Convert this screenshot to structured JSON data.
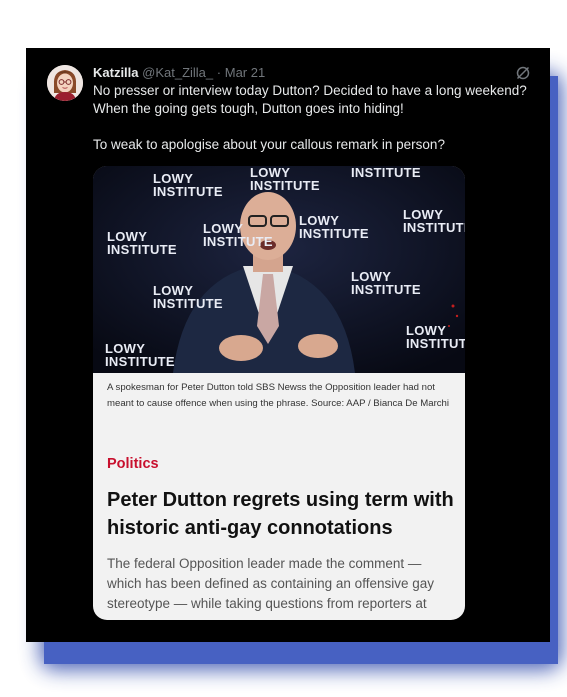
{
  "tweet": {
    "display_name": "Katzilla",
    "handle": "@Kat_Zilla_",
    "separator": "·",
    "date": "Mar 21",
    "text_lines": [
      "No presser or interview today Dutton? Decided to have a long weekend?",
      "When the going gets tough, Dutton goes into hiding!"
    ],
    "text_line_3": "To weak to apologise about your callous remark in person?"
  },
  "article": {
    "photo_logo_words": [
      "LOWY",
      "INSTITUTE"
    ],
    "caption": "A spokesman for Peter Dutton told SBS Newss the Opposition leader had not meant to cause offence when using the phrase. Source: AAP / Bianca De Marchi",
    "category": "Politics",
    "headline": "Peter Dutton regrets using term with historic anti-gay connotations",
    "summary": "The federal Opposition leader made the comment — which has been defined as containing an offensive gay stereotype — while taking questions from reporters at"
  },
  "colors": {
    "card_bg": "#000000",
    "frame_shadow": "#4761c2",
    "category": "#c8102e",
    "text_primary": "#e7e9ea",
    "text_muted": "#71767b"
  },
  "icons": {
    "header_right": "grok-icon"
  }
}
